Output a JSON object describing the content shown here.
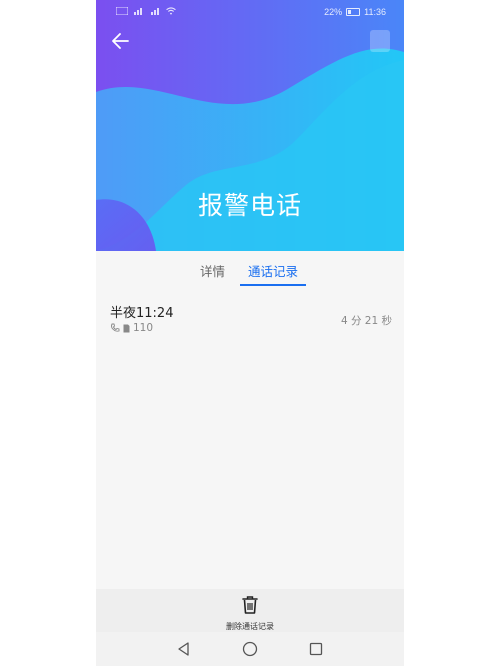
{
  "status_bar": {
    "battery_percent": "22%",
    "time": "11:36",
    "left_icons": [
      "signal-icon",
      "4g-icon",
      "signal-icon",
      "wifi-icon"
    ]
  },
  "header": {
    "title": "报警电话",
    "back_icon": "back-arrow-icon"
  },
  "tabs": [
    {
      "label": "详情",
      "active": false
    },
    {
      "label": "通话记录",
      "active": true
    }
  ],
  "call_log": [
    {
      "time": "半夜11:24",
      "number": "110",
      "duration": "4 分 21 秒"
    }
  ],
  "bottom_action": {
    "label": "删除通话记录",
    "icon": "trash-icon"
  },
  "colors": {
    "accent": "#1a6ff0",
    "hero_purple": "#6a5cf3",
    "hero_cyan": "#1ed2f5"
  }
}
